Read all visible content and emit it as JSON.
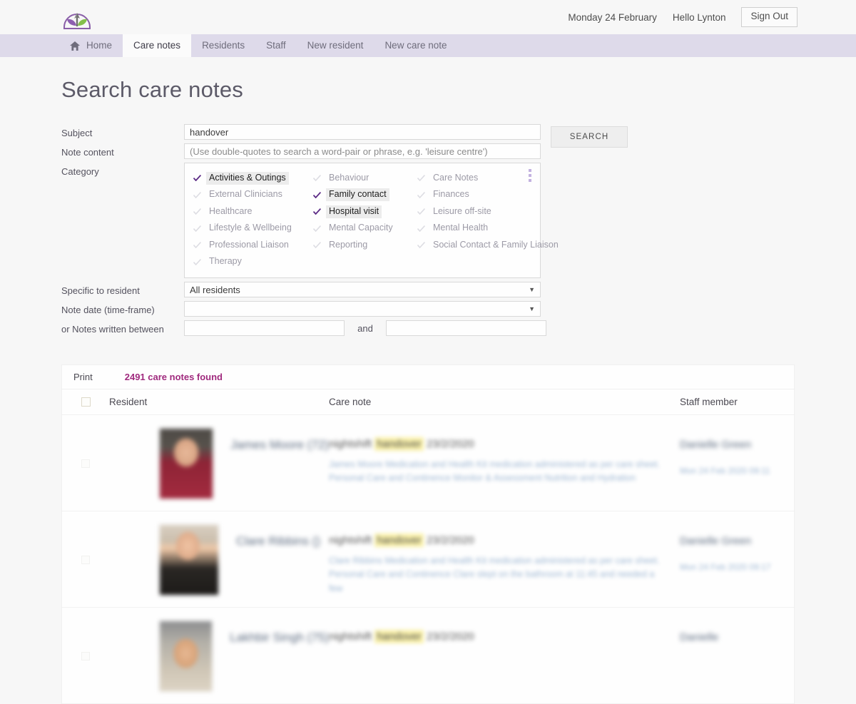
{
  "header": {
    "date": "Monday 24 February",
    "greeting": "Hello Lynton",
    "sign_out": "Sign Out",
    "logo_alt": "care-home-logo"
  },
  "nav": {
    "items": [
      {
        "label": "Home",
        "icon": "home-icon",
        "active": false
      },
      {
        "label": "Care notes",
        "icon": "",
        "active": true
      },
      {
        "label": "Residents",
        "icon": "",
        "active": false
      },
      {
        "label": "Staff",
        "icon": "",
        "active": false
      },
      {
        "label": "New resident",
        "icon": "",
        "active": false
      },
      {
        "label": "New care note",
        "icon": "",
        "active": false
      }
    ]
  },
  "page": {
    "title": "Search care notes"
  },
  "form": {
    "subject": {
      "label": "Subject",
      "value": "handover",
      "placeholder": ""
    },
    "note_content": {
      "label": "Note content",
      "value": "",
      "placeholder": "(Use double-quotes to search a word-pair or phrase, e.g. 'leisure centre')"
    },
    "category": {
      "label": "Category",
      "menu_icon": "kebab-menu-icon",
      "options": [
        {
          "label": "Activities & Outings",
          "checked": true
        },
        {
          "label": "Behaviour",
          "checked": false
        },
        {
          "label": "Care Notes",
          "checked": false
        },
        {
          "label": "External Clinicians",
          "checked": false
        },
        {
          "label": "Family contact",
          "checked": true
        },
        {
          "label": "Finances",
          "checked": false
        },
        {
          "label": "Healthcare",
          "checked": false
        },
        {
          "label": "Hospital visit",
          "checked": true
        },
        {
          "label": "Leisure off-site",
          "checked": false
        },
        {
          "label": "Lifestyle & Wellbeing",
          "checked": false
        },
        {
          "label": "Mental Capacity",
          "checked": false
        },
        {
          "label": "Mental Health",
          "checked": false
        },
        {
          "label": "Professional Liaison",
          "checked": false
        },
        {
          "label": "Reporting",
          "checked": false
        },
        {
          "label": "Social Contact & Family Liaison",
          "checked": false
        },
        {
          "label": "Therapy",
          "checked": false
        }
      ]
    },
    "specific_to_resident": {
      "label": "Specific to resident",
      "value": "All residents"
    },
    "note_date": {
      "label": "Note date (time-frame)",
      "value": ""
    },
    "written_between": {
      "label": "or Notes written between",
      "from_value": "",
      "and_label": "and",
      "to_value": ""
    },
    "search_button": "SEARCH"
  },
  "results": {
    "print_label": "Print",
    "count_text": "2491 care notes found",
    "columns": {
      "resident": "Resident",
      "care_note": "Care note",
      "staff": "Staff member"
    },
    "rows": [
      {
        "resident": "James Moore (72)",
        "avatar": "av1",
        "note_prefix": "nightshift",
        "note_highlight": "handover",
        "note_date": "23/2/2020",
        "note_body": "James Moore Medication and Health Kit medication administered as per care sheet. Personal Care and Continence Monitor & Assessment Nutrition and Hydration",
        "staff_name": "Danielle Green",
        "staff_time": "Mon 24 Feb 2020 09:11"
      },
      {
        "resident": "Clare Ribbins ()",
        "avatar": "av2",
        "note_prefix": "nightshift",
        "note_highlight": "handover",
        "note_date": "23/2/2020",
        "note_body": "Clare Ribbins Medication and Health Kit medication administered as per care sheet. Personal Care and Continence Clare slept on the bathroom at 11:45 and needed a few",
        "staff_name": "Danielle Green",
        "staff_time": "Mon 24 Feb 2020 09:17"
      },
      {
        "resident": "Lakhbir Singh (75)",
        "avatar": "av3",
        "note_prefix": "nightshift",
        "note_highlight": "handover",
        "note_date": "23/2/2020",
        "note_body": "",
        "staff_name": "Danielle",
        "staff_time": ""
      }
    ]
  },
  "colors": {
    "nav_bg": "#dedaea",
    "accent_magenta": "#a02a7e",
    "highlight_yellow": "#fbf2ab",
    "tick_purple": "#6b2f8f"
  }
}
